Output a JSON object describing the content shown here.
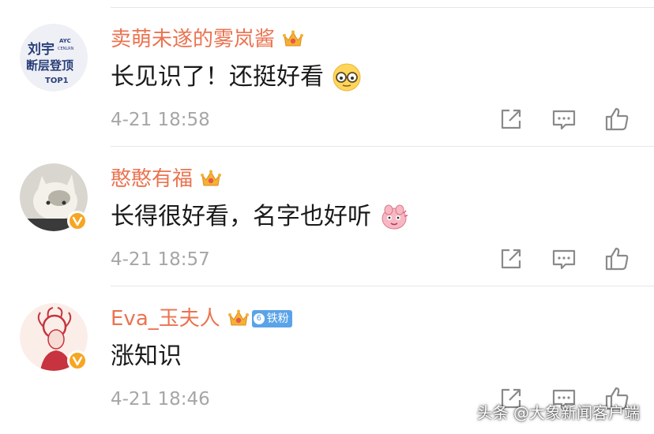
{
  "colors": {
    "username": "#eb7350",
    "content": "#1a1a1a",
    "timestamp": "#a6a6a6",
    "icon": "#8a8a8a",
    "verified_badge": "#f6a623",
    "fan_tag": "#5aa3e8"
  },
  "comments": [
    {
      "username": "卖萌未遂的雾岚酱",
      "badge_icon": "crown-icon",
      "content": "长见识了！还挺好看",
      "emoji": "glasses-face-emoji",
      "timestamp": "4-21 18:58",
      "avatar_text": {
        "line1": "刘宇",
        "line2": "断层登顶",
        "top_label": "TOP1",
        "small1": "AYC",
        "small2": "CENLRN"
      },
      "verified": false
    },
    {
      "username": "憨憨有福",
      "badge_icon": "crown-icon",
      "content": "长得很好看，名字也好听",
      "emoji": "pink-creature-emoji",
      "timestamp": "4-21 18:57",
      "verified": true
    },
    {
      "username": "Eva_玉夫人",
      "badge_icon": "crown-icon",
      "fan_tag": {
        "level": "6",
        "label": "铁粉"
      },
      "content": "涨知识",
      "timestamp": "4-21 18:46",
      "verified": true
    }
  ],
  "actions": {
    "share": "share-icon",
    "comment": "comment-icon",
    "like": "like-icon"
  },
  "watermark": "头条 @大象新闻客户端"
}
